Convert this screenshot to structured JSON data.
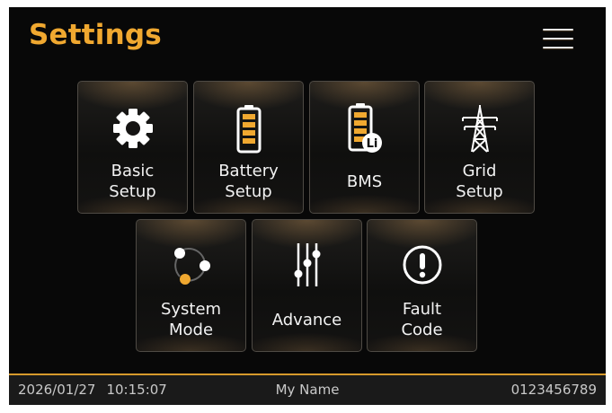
{
  "header": {
    "title": "Settings",
    "menu_icon": "hamburger-menu-icon"
  },
  "tiles": [
    {
      "icon": "gear-icon",
      "label_lines": [
        "Basic",
        "Setup"
      ]
    },
    {
      "icon": "battery-icon",
      "label_lines": [
        "Battery",
        "Setup"
      ]
    },
    {
      "icon": "battery-lithium-icon",
      "badge": "Li",
      "label_lines": [
        "BMS"
      ]
    },
    {
      "icon": "power-tower-icon",
      "label_lines": [
        "Grid",
        "Setup"
      ]
    },
    {
      "icon": "system-mode-icon",
      "label_lines": [
        "System",
        "Mode"
      ]
    },
    {
      "icon": "sliders-icon",
      "label_lines": [
        "Advance"
      ]
    },
    {
      "icon": "exclamation-circle-icon",
      "label_lines": [
        "Fault",
        "Code"
      ]
    }
  ],
  "footer": {
    "date": "2026/01/27",
    "time": "10:15:07",
    "name": "My Name",
    "serial": "0123456789"
  },
  "colors": {
    "accent": "#f0a830",
    "background": "#080808",
    "footer_line": "#d79a2c",
    "footer_bg": "#1a1a1a"
  }
}
